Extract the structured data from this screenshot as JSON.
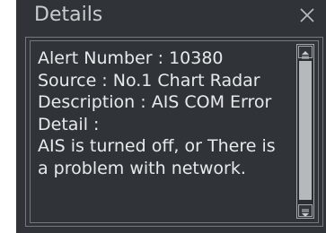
{
  "dialog": {
    "title": "Details",
    "close_icon": "close-icon",
    "lines": [
      "Alert Number : 10380",
      "Source : No.1 Chart Radar",
      "Description : AIS COM Error",
      "Detail :",
      "AIS is turned off, or There is",
      "a problem with network."
    ],
    "scrollbar": {
      "up_icon": "scroll-up-icon",
      "down_icon": "scroll-down-icon"
    }
  },
  "colors": {
    "background": "#303438",
    "text": "#e7eaec",
    "border": "#75797d",
    "thumb": "#b6b9bb"
  }
}
